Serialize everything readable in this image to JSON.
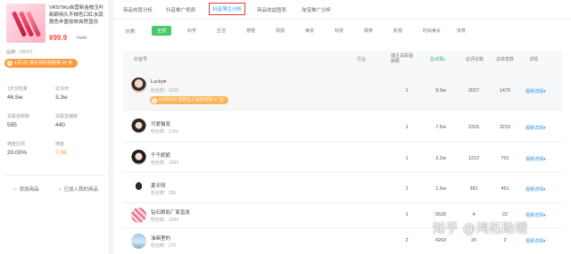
{
  "product": {
    "title": "VRSTIKo自营新金枝玉叶新颜持久不掉色口红水润唇色丰盈妆效自然显白",
    "price": "¥99.9",
    "price_old": "¥199",
    "meta_label": "品牌:",
    "meta_value": "VRSTI",
    "tag_icon": "钻",
    "tag_text": "1月1日 特价领好物赠券 25 券",
    "stats": [
      {
        "label": "1天浏览量",
        "value": "46.5w"
      },
      {
        "label": "近30天",
        "value": "3.3w"
      },
      {
        "label": "关联视频数",
        "value": "595"
      },
      {
        "label": "关联直播数",
        "value": "440"
      },
      {
        "label": "佣金比例",
        "value": "20.00%"
      },
      {
        "label": "佣金",
        "value": "7.08"
      }
    ],
    "btn_favorite": "添加商品",
    "btn_buy": "已加入我的商品"
  },
  "tabs": [
    {
      "label": "商品热度分析"
    },
    {
      "label": "抖音推广视频"
    },
    {
      "label": "抖音博主分析"
    },
    {
      "label": "商品收益图表"
    },
    {
      "label": "淘宝推广分析"
    }
  ],
  "category_label": "分类:",
  "categories": [
    "全部",
    "科学",
    "生活",
    "穿搭",
    "情感",
    "美妆",
    "科技",
    "搞笑",
    "影视",
    "时尚美女",
    "体育"
  ],
  "table": {
    "headers": [
      "抖音号",
      "行业",
      "博主关联视频数",
      "总点赞",
      "总评论数",
      "总转发数",
      "详情"
    ],
    "sort_arrow": "▾",
    "detail_label": "视频详情",
    "detail_arrow": "▾"
  },
  "rows": [
    {
      "name": "Lucky",
      "heart": "♥",
      "fans": "粉丝数：2020",
      "tag_icon": "钻",
      "tag": "01月09日 电商达人涨粉榜单 37 名",
      "videos": "1",
      "likes": "9.0w",
      "comments": "2027",
      "shares": "1470"
    },
    {
      "name": "可爱猫宠",
      "fans": "粉丝数：2.9w",
      "videos": "1",
      "likes": "7.6w",
      "comments": "2315",
      "shares": "3215"
    },
    {
      "name": "千千妮妮",
      "fans": "粉丝数：1694",
      "videos": "1",
      "likes": "2.2w",
      "comments": "1212",
      "shares": "701"
    },
    {
      "name": "夏天呀",
      "fans": "粉丝数：356",
      "videos": "1",
      "likes": "1.6w",
      "comments": "381",
      "shares": "451"
    },
    {
      "name": "钻石眼影厂家直发",
      "fans": "粉丝数：1094",
      "videos": "1",
      "likes": "5630",
      "comments": "4",
      "shares": "22"
    },
    {
      "name": "油画里的",
      "fans": "粉丝数：272",
      "videos": "2",
      "likes": "4263",
      "comments": "20",
      "shares": "2"
    }
  ],
  "watermark": "知乎 @鸿拓助理",
  "colors": {
    "accent_blue": "#2aa2f0",
    "active_green": "#47c96b",
    "highlight_red": "#e63b3b",
    "orange": "#ff9a3c",
    "link_blue": "#2b8ee6"
  }
}
